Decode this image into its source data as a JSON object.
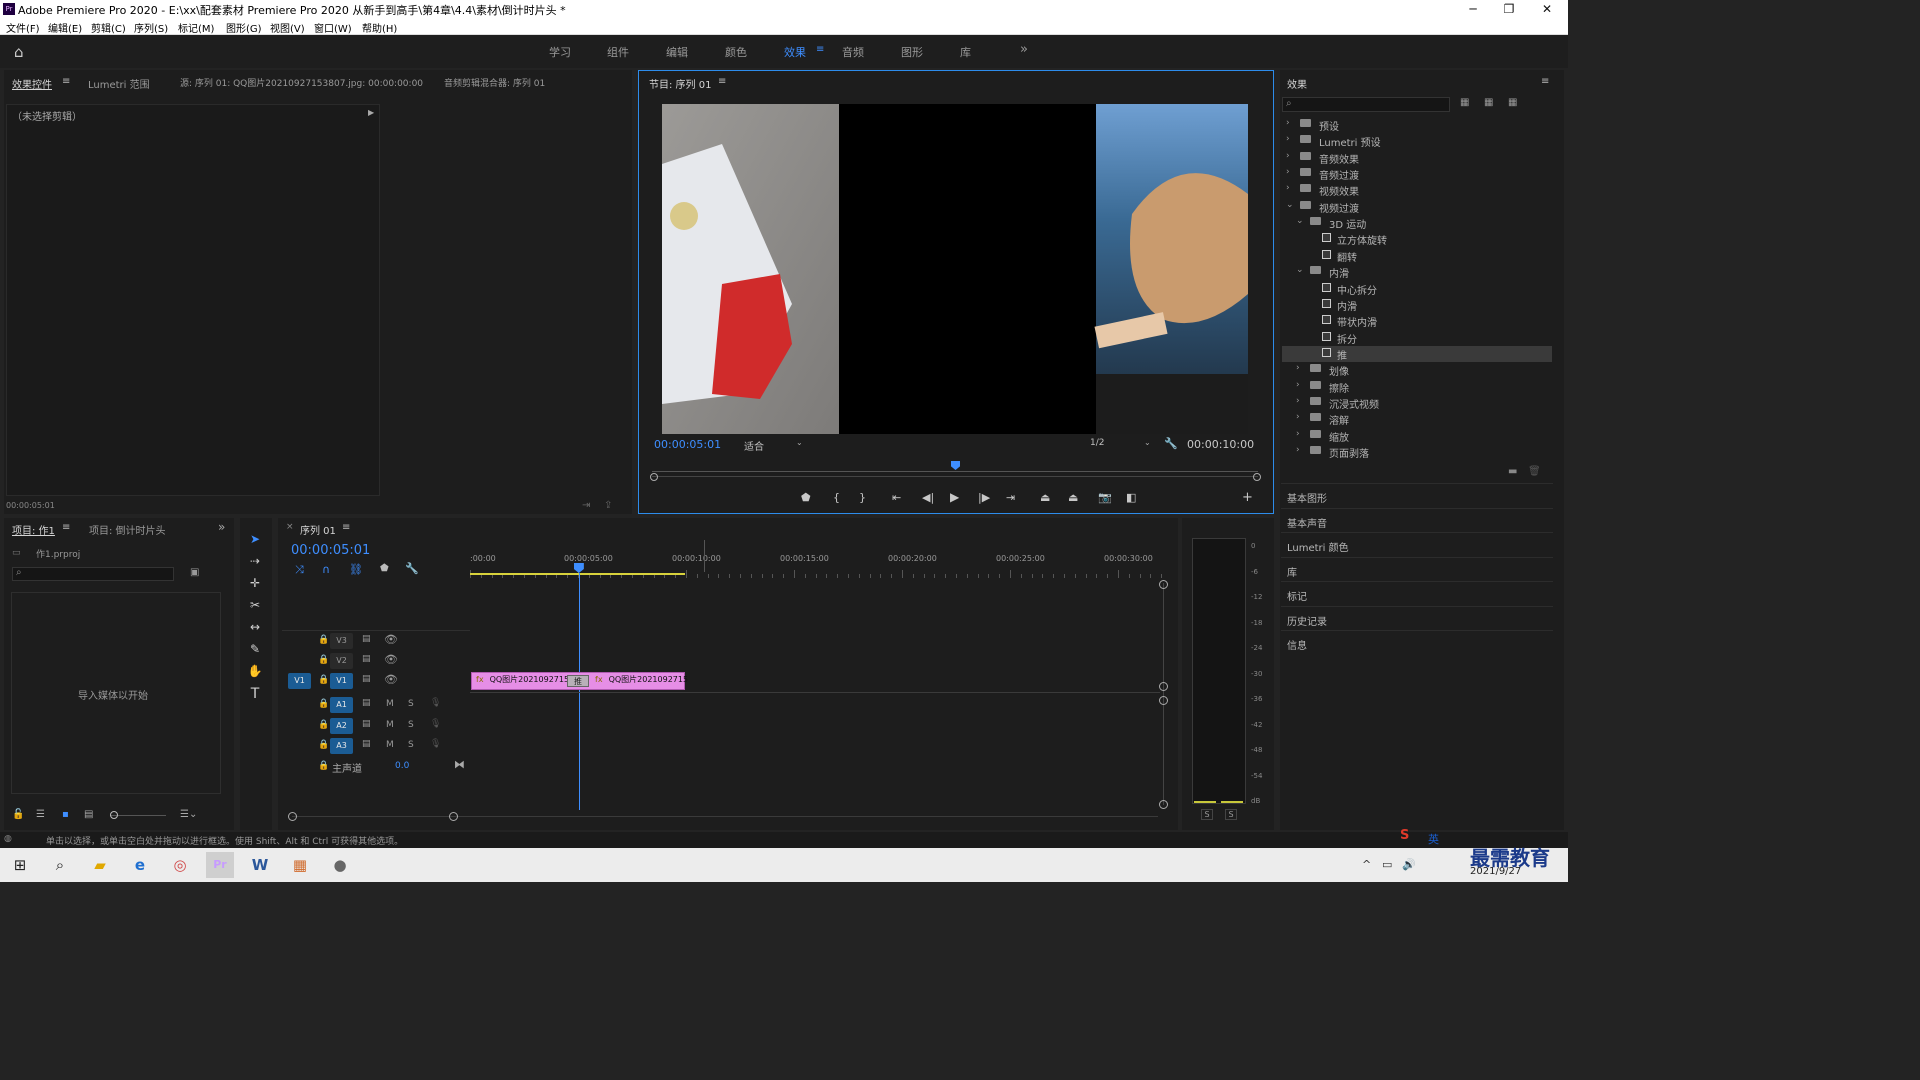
{
  "app": {
    "title": "Adobe Premiere Pro 2020 - E:\\xx\\配套素材 Premiere Pro 2020 从新手到高手\\第4章\\4.4\\素材\\倒计时片头 *"
  },
  "menu": [
    "文件(F)",
    "编辑(E)",
    "剪辑(C)",
    "序列(S)",
    "标记(M)",
    "图形(G)",
    "视图(V)",
    "窗口(W)",
    "帮助(H)"
  ],
  "workspaces": [
    "学习",
    "组件",
    "编辑",
    "颜色",
    "效果",
    "音频",
    "图形",
    "库"
  ],
  "window_controls": {
    "minimize": "─",
    "maximize": "❐",
    "close": "✕"
  },
  "source_panel": {
    "tabs": [
      "效果控件",
      "Lumetri 范围",
      "源: 序列 01: QQ图片20210927153807.jpg: 00:00:00:00",
      "音频剪辑混合器: 序列 01"
    ],
    "no_clip": "（未选择剪辑）",
    "timecode": "00:00:05:01"
  },
  "program": {
    "title": "节目: 序列 01",
    "timecode": "00:00:05:01",
    "fit": "适合",
    "res": "1/2",
    "duration": "00:00:10:00",
    "playhead_fraction": 0.5
  },
  "effects": {
    "title": "效果",
    "search_placeholder": "",
    "tree": [
      {
        "label": "预设",
        "level": 0,
        "type": "folder",
        "arrow": "›"
      },
      {
        "label": "Lumetri 预设",
        "level": 0,
        "type": "folder",
        "arrow": "›"
      },
      {
        "label": "音频效果",
        "level": 0,
        "type": "folder",
        "arrow": "›"
      },
      {
        "label": "音频过渡",
        "level": 0,
        "type": "folder",
        "arrow": "›"
      },
      {
        "label": "视频效果",
        "level": 0,
        "type": "folder",
        "arrow": "›"
      },
      {
        "label": "视频过渡",
        "level": 0,
        "type": "folder",
        "arrow": "⌄"
      },
      {
        "label": "3D 运动",
        "level": 1,
        "type": "folder",
        "arrow": "⌄"
      },
      {
        "label": "立方体旋转",
        "level": 2,
        "type": "fx",
        "arrow": ""
      },
      {
        "label": "翻转",
        "level": 2,
        "type": "fx",
        "arrow": ""
      },
      {
        "label": "内滑",
        "level": 1,
        "type": "folder",
        "arrow": "⌄"
      },
      {
        "label": "中心拆分",
        "level": 2,
        "type": "fx",
        "arrow": ""
      },
      {
        "label": "内滑",
        "level": 2,
        "type": "fx",
        "arrow": ""
      },
      {
        "label": "带状内滑",
        "level": 2,
        "type": "fx",
        "arrow": ""
      },
      {
        "label": "拆分",
        "level": 2,
        "type": "fx",
        "arrow": ""
      },
      {
        "label": "推",
        "level": 2,
        "type": "fx",
        "arrow": "",
        "selected": true
      },
      {
        "label": "划像",
        "level": 1,
        "type": "folder",
        "arrow": "›"
      },
      {
        "label": "擦除",
        "level": 1,
        "type": "folder",
        "arrow": "›"
      },
      {
        "label": "沉浸式视频",
        "level": 1,
        "type": "folder",
        "arrow": "›"
      },
      {
        "label": "溶解",
        "level": 1,
        "type": "folder",
        "arrow": "›"
      },
      {
        "label": "缩放",
        "level": 1,
        "type": "folder",
        "arrow": "›"
      },
      {
        "label": "页面剥落",
        "level": 1,
        "type": "folder",
        "arrow": "›"
      }
    ],
    "sections": [
      "基本图形",
      "基本声音",
      "Lumetri 颜色",
      "库",
      "标记",
      "历史记录",
      "信息"
    ]
  },
  "project": {
    "tabs": [
      "项目: 作1",
      "项目: 倒计时片头"
    ],
    "file": "作1.prproj",
    "import_hint": "导入媒体以开始"
  },
  "timeline": {
    "tab": "序列 01",
    "timecode": "00:00:05:01",
    "ruler": [
      ":00:00",
      "00:00:05:00",
      "00:00:10:00",
      "00:00:15:00",
      "00:00:20:00",
      "00:00:25:00",
      "00:00:30:00"
    ],
    "tracks": {
      "v": [
        "V3",
        "V2",
        "V1"
      ],
      "a": [
        "A1",
        "A2",
        "A3"
      ],
      "src": "V1",
      "master": "主声道",
      "master_val": "0.0",
      "m": "M",
      "s": "S"
    },
    "clips": [
      {
        "label": "QQ图片2021092715"
      },
      {
        "label": "QQ图片2021092715"
      }
    ],
    "transition": "推"
  },
  "meter": {
    "scale": [
      "0",
      "-6",
      "-12",
      "-18",
      "-24",
      "-30",
      "-36",
      "-42",
      "-48",
      "-54",
      "dB"
    ],
    "solo": [
      "S",
      "S"
    ]
  },
  "status": "单击以选择，或单击空白处并拖动以进行框选。使用 Shift、Alt 和 Ctrl 可获得其他选项。",
  "taskbar": {
    "date": "2021/9/27",
    "ime": "英",
    "watermark": "最需教育"
  }
}
